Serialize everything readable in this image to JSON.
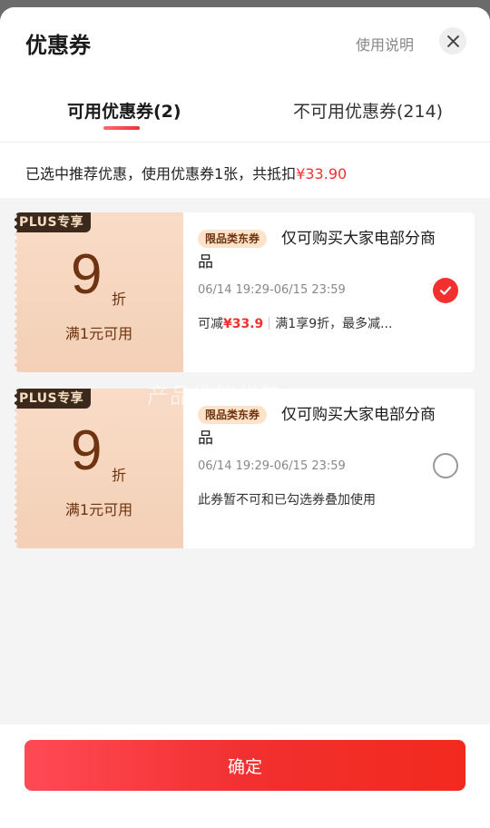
{
  "header": {
    "title": "优惠券",
    "help_link": "使用说明",
    "close_icon": "close-icon"
  },
  "tabs": [
    {
      "label": "可用优惠券(2)",
      "active": true
    },
    {
      "label": "不可用优惠券(214)",
      "active": false
    }
  ],
  "summary": {
    "prefix": "已选中推荐优惠，使用优惠券1张，共抵扣",
    "amount": "¥33.90"
  },
  "coupons": [
    {
      "tag": "PLUS专享",
      "discount": "9",
      "unit": "折",
      "threshold": "满1元可用",
      "badge": "限品类东券",
      "title": "仅可购买大家电部分商品",
      "validity": "06/14 19:29-06/15 23:59",
      "desc_prefix": "可减",
      "desc_amount": "¥33.9",
      "desc_rest": "满1享9折，最多减...",
      "selected": true
    },
    {
      "tag": "PLUS专享",
      "discount": "9",
      "unit": "折",
      "threshold": "满1元可用",
      "badge": "限品类东券",
      "title": "仅可购买大家电部分商品",
      "validity": "06/14 19:29-06/15 23:59",
      "desc": "此券暂不可和已勾选券叠加使用",
      "selected": false
    }
  ],
  "watermark": "产品性能优势",
  "footer": {
    "confirm_label": "确定"
  },
  "colors": {
    "accent": "#f23030",
    "coupon_brown": "#6e3310",
    "plus_tag_bg": "#3b2a1c"
  }
}
